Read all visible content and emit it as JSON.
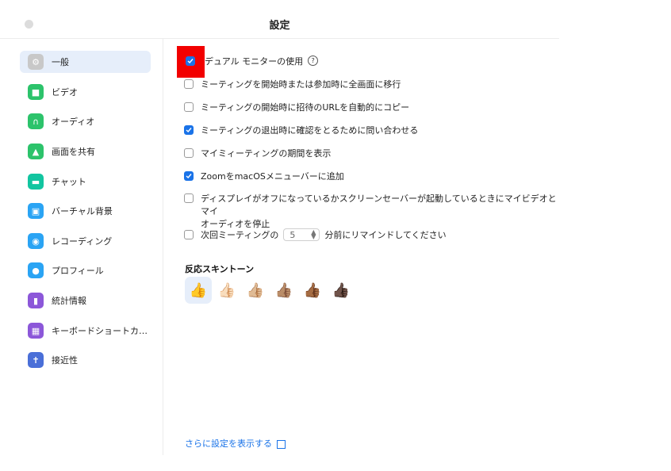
{
  "window": {
    "title": "設定"
  },
  "sidebar": {
    "items": [
      {
        "label": "一般",
        "icon": "gear-icon",
        "color": "#c8c8c8",
        "selected": true
      },
      {
        "label": "ビデオ",
        "icon": "video-icon",
        "color": "#2cc36b",
        "selected": false
      },
      {
        "label": "オーディオ",
        "icon": "headphones-icon",
        "color": "#2cc36b",
        "selected": false
      },
      {
        "label": "画面を共有",
        "icon": "share-screen-icon",
        "color": "#2cc36b",
        "selected": false
      },
      {
        "label": "チャット",
        "icon": "chat-icon",
        "color": "#12c5a0",
        "selected": false
      },
      {
        "label": "バーチャル背景",
        "icon": "virtual-background-icon",
        "color": "#2aa4f4",
        "selected": false
      },
      {
        "label": "レコーディング",
        "icon": "recording-icon",
        "color": "#2aa4f4",
        "selected": false
      },
      {
        "label": "プロフィール",
        "icon": "profile-icon",
        "color": "#2aa4f4",
        "selected": false
      },
      {
        "label": "統計情報",
        "icon": "statistics-icon",
        "color": "#8c57d9",
        "selected": false
      },
      {
        "label": "キーボードショートカ…",
        "icon": "keyboard-icon",
        "color": "#8c57d9",
        "selected": false
      },
      {
        "label": "接近性",
        "icon": "accessibility-icon",
        "color": "#4a6fd8",
        "selected": false
      }
    ]
  },
  "general": {
    "options": [
      {
        "label": "デュアル モニターの使用",
        "checked": true,
        "help": "?"
      },
      {
        "label": "ミーティングを開始時または参加時に全画面に移行",
        "checked": false
      },
      {
        "label": "ミーティングの開始時に招待のURLを自動的にコピー",
        "checked": false
      },
      {
        "label": "ミーティングの退出時に確認をとるために問い合わせる",
        "checked": true
      },
      {
        "label": "マイミィーティングの期間を表示",
        "checked": false
      },
      {
        "label": "ZoomをmacOSメニューバーに追加",
        "checked": true
      },
      {
        "label": "ディスプレイがオフになっているかスクリーンセーバーが起動しているときにマイビデオとマイ",
        "label2": "オーディオを停止",
        "checked": false
      }
    ],
    "reminder": {
      "prefix": "次回ミーティングの",
      "value": "5",
      "suffix": "分前にリマインドしてください",
      "checked": false
    },
    "skin_tone": {
      "title": "反応スキントーン",
      "options": [
        "👍",
        "👍🏻",
        "👍🏼",
        "👍🏽",
        "👍🏾",
        "👍🏿"
      ],
      "selected_index": 0
    },
    "more_link": "さらに設定を表示する"
  },
  "colors": {
    "accent": "#1a73e8",
    "highlight": "#f20000",
    "selection": "#e6eefa"
  }
}
